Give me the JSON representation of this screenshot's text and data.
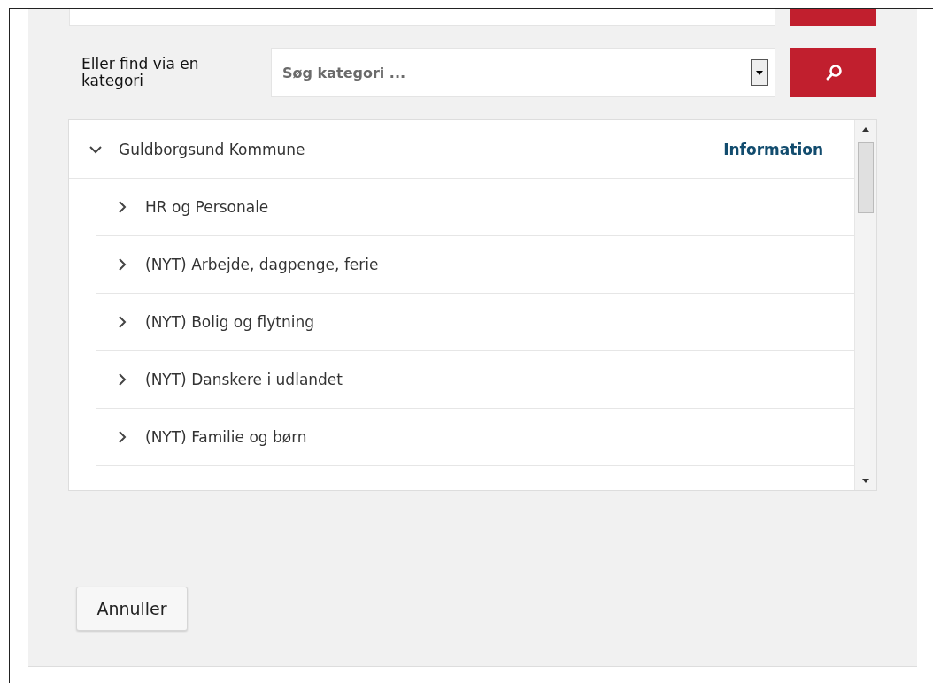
{
  "category_search": {
    "label": "Eller find via en kategori",
    "placeholder": "Søg kategori ..."
  },
  "tree": {
    "root": {
      "label": "Guldborgsund Kommune",
      "expanded": true,
      "action": "Information",
      "children": [
        {
          "label": "HR og Personale",
          "expanded": false
        },
        {
          "label": "(NYT) Arbejde, dagpenge, ferie",
          "expanded": false
        },
        {
          "label": "(NYT) Bolig og flytning",
          "expanded": false
        },
        {
          "label": "(NYT) Danskere i udlandet",
          "expanded": false
        },
        {
          "label": "(NYT) Familie og børn",
          "expanded": false
        }
      ]
    }
  },
  "buttons": [
    {
      "label": "Annuller"
    }
  ]
}
